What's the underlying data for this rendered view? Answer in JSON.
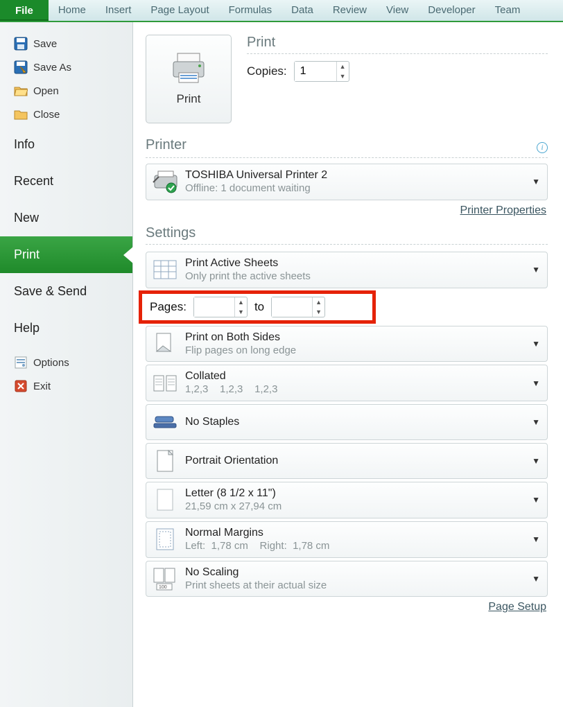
{
  "ribbon": {
    "tabs": [
      "File",
      "Home",
      "Insert",
      "Page Layout",
      "Formulas",
      "Data",
      "Review",
      "View",
      "Developer",
      "Team"
    ]
  },
  "sidebar": {
    "quick": [
      {
        "label": "Save",
        "icon": "save"
      },
      {
        "label": "Save As",
        "icon": "save-as"
      },
      {
        "label": "Open",
        "icon": "folder-open"
      },
      {
        "label": "Close",
        "icon": "folder-close"
      }
    ],
    "sections": [
      "Info",
      "Recent",
      "New",
      "Print",
      "Save & Send",
      "Help"
    ],
    "active_section": "Print",
    "footer": [
      {
        "label": "Options",
        "icon": "options"
      },
      {
        "label": "Exit",
        "icon": "exit"
      }
    ]
  },
  "print": {
    "button_label": "Print",
    "heading": "Print",
    "copies_label": "Copies:",
    "copies_value": "1"
  },
  "printer": {
    "heading": "Printer",
    "name": "TOSHIBA Universal Printer 2",
    "status": "Offline: 1 document waiting",
    "properties_link": "Printer Properties"
  },
  "settings": {
    "heading": "Settings",
    "active_sheets": {
      "line1": "Print Active Sheets",
      "line2": "Only print the active sheets"
    },
    "pages": {
      "label": "Pages:",
      "from": "",
      "to_label": "to",
      "to": ""
    },
    "both_sides": {
      "line1": "Print on Both Sides",
      "line2": "Flip pages on long edge"
    },
    "collated": {
      "line1": "Collated",
      "line2": "1,2,3    1,2,3    1,2,3"
    },
    "staples": {
      "line1": "No Staples"
    },
    "orientation": {
      "line1": "Portrait Orientation"
    },
    "paper": {
      "line1": "Letter (8 1/2 x 11\")",
      "line2": "21,59 cm x 27,94 cm"
    },
    "margins": {
      "line1": "Normal Margins",
      "line2": "Left:  1,78 cm    Right:  1,78 cm"
    },
    "scaling": {
      "line1": "No Scaling",
      "line2": "Print sheets at their actual size"
    },
    "page_setup_link": "Page Setup"
  }
}
